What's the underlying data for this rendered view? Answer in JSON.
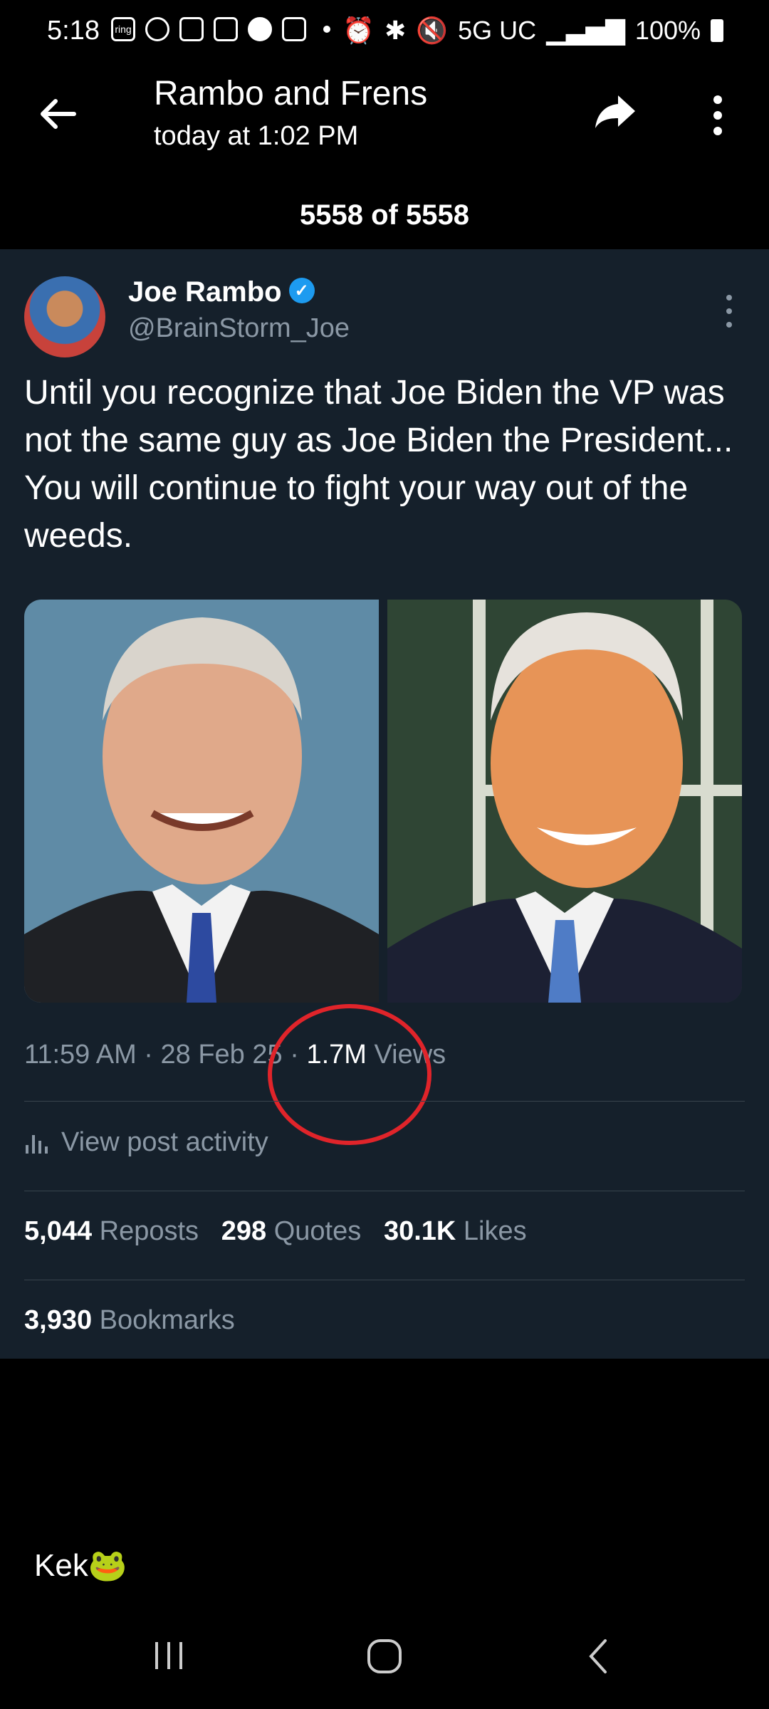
{
  "status_bar": {
    "time": "5:18",
    "ring_label": "ring",
    "network": "5G UC",
    "battery": "100%"
  },
  "header": {
    "title": "Rambo and Frens",
    "subtitle": "today at 1:02 PM",
    "counter": "5558 of 5558"
  },
  "tweet": {
    "author_name": "Joe Rambo",
    "handle": "@BrainStorm_Joe",
    "text": "Until you recognize that Joe Biden the VP was not the same guy as Joe Biden the President... You will continue to fight your way out of the weeds.",
    "time": "11:59 AM",
    "date": "28 Feb 25",
    "views_count": "1.7M",
    "views_label": "Views",
    "activity_label": "View post activity",
    "reposts_count": "5,044",
    "reposts_label": "Reposts",
    "quotes_count": "298",
    "quotes_label": "Quotes",
    "likes_count": "30.1K",
    "likes_label": "Likes",
    "bookmarks_count": "3,930",
    "bookmarks_label": "Bookmarks"
  },
  "message": {
    "text": "Kek🐸"
  },
  "colors": {
    "card_bg": "#15202b",
    "muted_text": "#8b98a5",
    "verified_blue": "#1d9bf0",
    "annotation_red": "#e0242a"
  }
}
